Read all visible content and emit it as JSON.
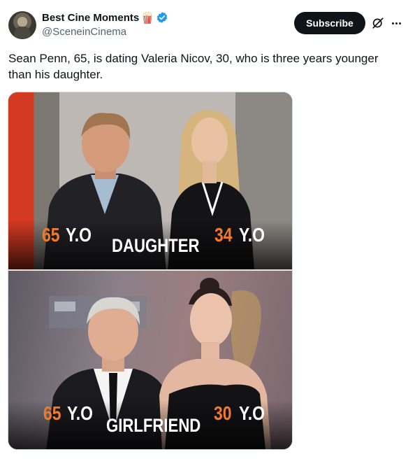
{
  "post": {
    "display_name": "Best Cine Moments",
    "handle": "@SceneinCinema",
    "subscribe_label": "Subscribe",
    "text": "Sean Penn, 65, is dating Valeria Nicov, 30, who is three years younger than his daughter.",
    "icons": {
      "name_emoji": "popcorn-icon",
      "badge": "verified-icon",
      "grok": "grok-icon",
      "more": "more-icon"
    },
    "colors": {
      "verified": "#1d9bf0",
      "accent_age": "#f07a2a",
      "button_bg": "#0f1419"
    }
  },
  "media": {
    "top": {
      "left_age": "65",
      "left_suffix": "Y.O",
      "center_label": "DAUGHTER",
      "right_age": "34",
      "right_suffix": "Y.O"
    },
    "bottom": {
      "left_age": "65",
      "left_suffix": "Y.O",
      "center_label": "GIRLFRIEND",
      "right_age": "30",
      "right_suffix": "Y.O"
    }
  }
}
